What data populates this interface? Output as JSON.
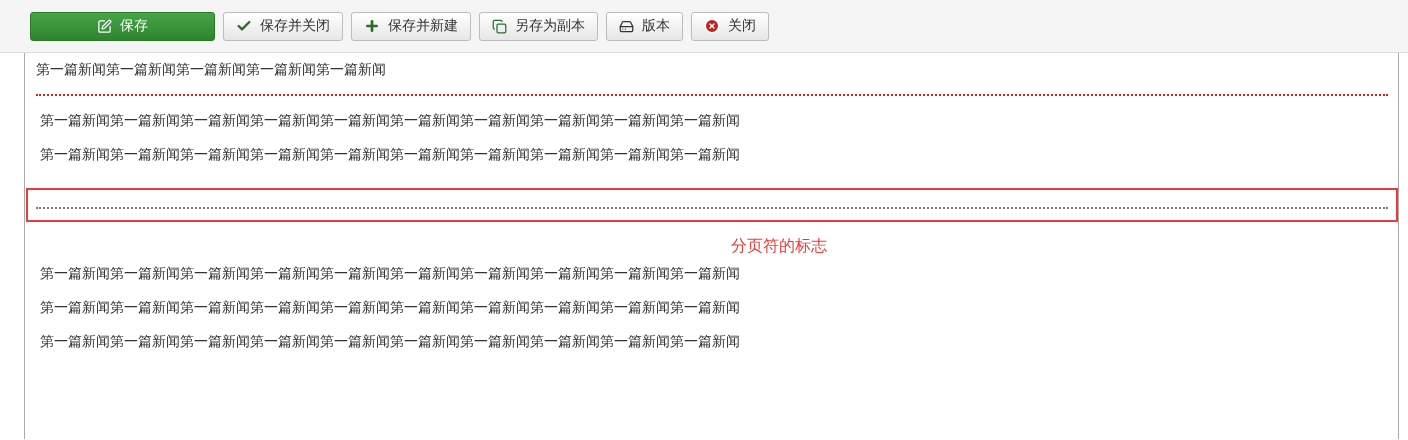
{
  "toolbar": {
    "buttons": [
      {
        "label": "保存",
        "kind": "save",
        "primary": true
      },
      {
        "label": "保存并关闭",
        "kind": "check",
        "primary": false
      },
      {
        "label": "保存并新建",
        "kind": "plus",
        "primary": false
      },
      {
        "label": "另存为副本",
        "kind": "copy",
        "primary": false
      },
      {
        "label": "版本",
        "kind": "versions",
        "primary": false
      },
      {
        "label": "关闭",
        "kind": "close",
        "primary": false
      }
    ]
  },
  "editor": {
    "title_line": "第一篇新闻第一篇新闻第一篇新闻第一篇新闻第一篇新闻",
    "paragraphs_before": [
      "第一篇新闻第一篇新闻第一篇新闻第一篇新闻第一篇新闻第一篇新闻第一篇新闻第一篇新闻第一篇新闻第一篇新闻",
      "第一篇新闻第一篇新闻第一篇新闻第一篇新闻第一篇新闻第一篇新闻第一篇新闻第一篇新闻第一篇新闻第一篇新闻"
    ],
    "page_break_note": "分页符的标志",
    "paragraphs_after": [
      "第一篇新闻第一篇新闻第一篇新闻第一篇新闻第一篇新闻第一篇新闻第一篇新闻第一篇新闻第一篇新闻第一篇新闻",
      "第一篇新闻第一篇新闻第一篇新闻第一篇新闻第一篇新闻第一篇新闻第一篇新闻第一篇新闻第一篇新闻第一篇新闻",
      "第一篇新闻第一篇新闻第一篇新闻第一篇新闻第一篇新闻第一篇新闻第一篇新闻第一篇新闻第一篇新闻第一篇新闻"
    ]
  }
}
